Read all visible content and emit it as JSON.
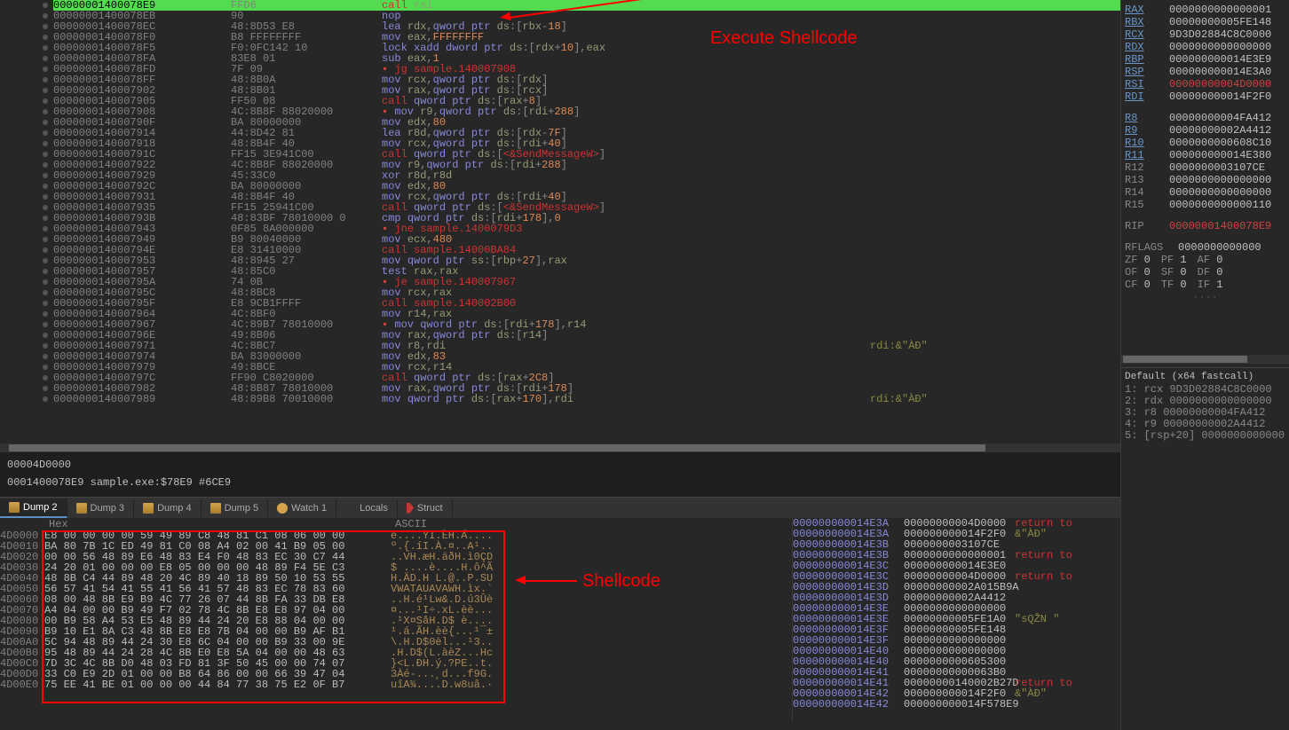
{
  "annotations": {
    "execute_shellcode": "Execute Shellcode",
    "shellcode": "Shellcode"
  },
  "status": {
    "line1": "00004D0000",
    "line2": "0001400078E9 sample.exe:$78E9 #6CE9"
  },
  "tabs": {
    "dump2": "Dump 2",
    "dump3": "Dump 3",
    "dump4": "Dump 4",
    "dump5": "Dump 5",
    "watch1": "Watch 1",
    "locals": "Locals",
    "struct": "Struct"
  },
  "hex_header": {
    "hex": "Hex",
    "ascii": "ASCII"
  },
  "disasm": [
    {
      "addr": "00000001400078E9",
      "bytes": "FFD6",
      "instr": [
        "call ",
        "rsi"
      ],
      "type": "call",
      "hl": true
    },
    {
      "addr": "00000001400078EB",
      "bytes": "90",
      "instr": [
        "nop"
      ],
      "type": "plain"
    },
    {
      "addr": "00000001400078EC",
      "bytes": "48:8D53 E8",
      "instr": [
        "lea ",
        "rdx",
        ",",
        "qword ptr ",
        "ds",
        ":",
        "[",
        "rbx",
        "-",
        "18",
        "]"
      ],
      "type": "plain"
    },
    {
      "addr": "00000001400078F0",
      "bytes": "B8 FFFFFFFF",
      "instr": [
        "mov ",
        "eax",
        ",",
        "FFFFFFFF"
      ],
      "type": "plain"
    },
    {
      "addr": "00000001400078F5",
      "bytes": "F0:0FC142 10",
      "instr": [
        "lock xadd ",
        "dword ptr ",
        "ds",
        ":",
        "[",
        "rdx",
        "+",
        "10",
        "],",
        "eax"
      ],
      "type": "plain"
    },
    {
      "addr": "00000001400078FA",
      "bytes": "83E8 01",
      "instr": [
        "sub ",
        "eax",
        ",",
        "1"
      ],
      "type": "plain"
    },
    {
      "addr": "00000001400078FD",
      "bytes": "7F 09",
      "instr": [
        "jg ",
        "sample.140007908"
      ],
      "type": "jmp",
      "marker": ">"
    },
    {
      "addr": "00000001400078FF",
      "bytes": "48:8B0A",
      "instr": [
        "mov ",
        "rcx",
        ",",
        "qword ptr ",
        "ds",
        ":",
        "[",
        "rdx",
        "]"
      ],
      "type": "plain"
    },
    {
      "addr": "0000000140007902",
      "bytes": "48:8B01",
      "instr": [
        "mov ",
        "rax",
        ",",
        "qword ptr ",
        "ds",
        ":",
        "[",
        "rcx",
        "]"
      ],
      "type": "plain"
    },
    {
      "addr": "0000000140007905",
      "bytes": "FF50 08",
      "instr": [
        "call ",
        "qword ptr ",
        "ds",
        ":",
        "[",
        "rax",
        "+",
        "8",
        "]"
      ],
      "type": "call"
    },
    {
      "addr": "0000000140007908",
      "bytes": "4C:8B8F 88020000",
      "instr": [
        "mov ",
        "r9",
        ",",
        "qword ptr ",
        "ds",
        ":",
        "[",
        "rdi",
        "+",
        "288",
        "]"
      ],
      "type": "plain",
      "marker": ">"
    },
    {
      "addr": "000000014000790F",
      "bytes": "BA 80000000",
      "instr": [
        "mov ",
        "edx",
        ",",
        "80"
      ],
      "type": "plain"
    },
    {
      "addr": "0000000140007914",
      "bytes": "44:8D42 81",
      "instr": [
        "lea ",
        "r8d",
        ",",
        "qword ptr ",
        "ds",
        ":",
        "[",
        "rdx",
        "-",
        "7F",
        "]"
      ],
      "type": "plain"
    },
    {
      "addr": "0000000140007918",
      "bytes": "48:8B4F 40",
      "instr": [
        "mov ",
        "rcx",
        ",",
        "qword ptr ",
        "ds",
        ":",
        "[",
        "rdi",
        "+",
        "40",
        "]"
      ],
      "type": "plain"
    },
    {
      "addr": "000000014000791C",
      "bytes": "FF15 3E941C00",
      "instr": [
        "call ",
        "qword ptr ",
        "ds",
        ":",
        "[",
        "<&SendMessageW>",
        "]"
      ],
      "type": "call"
    },
    {
      "addr": "0000000140007922",
      "bytes": "4C:8B8F 88020000",
      "instr": [
        "mov ",
        "r9",
        ",",
        "qword ptr ",
        "ds",
        ":",
        "[",
        "rdi",
        "+",
        "288",
        "]"
      ],
      "type": "plain"
    },
    {
      "addr": "0000000140007929",
      "bytes": "45:33C0",
      "instr": [
        "xor ",
        "r8d",
        ",",
        "r8d"
      ],
      "type": "plain"
    },
    {
      "addr": "000000014000792C",
      "bytes": "BA 80000000",
      "instr": [
        "mov ",
        "edx",
        ",",
        "80"
      ],
      "type": "plain"
    },
    {
      "addr": "0000000140007931",
      "bytes": "48:8B4F 40",
      "instr": [
        "mov ",
        "rcx",
        ",",
        "qword ptr ",
        "ds",
        ":",
        "[",
        "rdi",
        "+",
        "40",
        "]"
      ],
      "type": "plain"
    },
    {
      "addr": "0000000140007935",
      "bytes": "FF15 25941C00",
      "instr": [
        "call ",
        "qword ptr ",
        "ds",
        ":",
        "[",
        "<&SendMessageW>",
        "]"
      ],
      "type": "call"
    },
    {
      "addr": "000000014000793B",
      "bytes": "48:83BF 78010000 0",
      "instr": [
        "cmp ",
        "qword ptr ",
        "ds",
        ":",
        "[",
        "rdi",
        "+",
        "178",
        "],",
        "0"
      ],
      "type": "plain"
    },
    {
      "addr": "0000000140007943",
      "bytes": "0F85 8A000000",
      "instr": [
        "jne ",
        "sample.1400079D3"
      ],
      "type": "jmp",
      "marker": ">"
    },
    {
      "addr": "0000000140007949",
      "bytes": "B9 80040000",
      "instr": [
        "mov ",
        "ecx",
        ",",
        "480"
      ],
      "type": "plain"
    },
    {
      "addr": "000000014000794E",
      "bytes": "E8 31410000",
      "instr": [
        "call ",
        "sample.14000BA84"
      ],
      "type": "call"
    },
    {
      "addr": "0000000140007953",
      "bytes": "48:8945 27",
      "instr": [
        "mov ",
        "qword ptr ",
        "ss",
        ":",
        "[",
        "rbp",
        "+",
        "27",
        "],",
        "rax"
      ],
      "type": "plain"
    },
    {
      "addr": "0000000140007957",
      "bytes": "48:85C0",
      "instr": [
        "test ",
        "rax",
        ",",
        "rax"
      ],
      "type": "plain"
    },
    {
      "addr": "000000014000795A",
      "bytes": "74 0B",
      "instr": [
        "je ",
        "sample.140007967"
      ],
      "type": "jmp",
      "marker": ">"
    },
    {
      "addr": "000000014000795C",
      "bytes": "48:8BC8",
      "instr": [
        "mov ",
        "rcx",
        ",",
        "rax"
      ],
      "type": "plain"
    },
    {
      "addr": "000000014000795F",
      "bytes": "E8 9CB1FFFF",
      "instr": [
        "call ",
        "sample.140002B00"
      ],
      "type": "call"
    },
    {
      "addr": "0000000140007964",
      "bytes": "4C:8BF0",
      "instr": [
        "mov ",
        "r14",
        ",",
        "rax"
      ],
      "type": "plain"
    },
    {
      "addr": "0000000140007967",
      "bytes": "4C:89B7 78010000",
      "instr": [
        "mov ",
        "qword ptr ",
        "ds",
        ":",
        "[",
        "rdi",
        "+",
        "178",
        "],",
        "r14"
      ],
      "type": "plain",
      "marker": ">"
    },
    {
      "addr": "000000014000796E",
      "bytes": "49:8B06",
      "instr": [
        "mov ",
        "rax",
        ",",
        "qword ptr ",
        "ds",
        ":",
        "[",
        "r14",
        "]"
      ],
      "type": "plain"
    },
    {
      "addr": "0000000140007971",
      "bytes": "4C:8BC7",
      "instr": [
        "mov ",
        "r8",
        ",",
        "rdi"
      ],
      "type": "plain",
      "cmnt": "rdi:&\"ÀÐ\""
    },
    {
      "addr": "0000000140007974",
      "bytes": "BA 83000000",
      "instr": [
        "mov ",
        "edx",
        ",",
        "83"
      ],
      "type": "plain"
    },
    {
      "addr": "0000000140007979",
      "bytes": "49:8BCE",
      "instr": [
        "mov ",
        "rcx",
        ",",
        "r14"
      ],
      "type": "plain"
    },
    {
      "addr": "000000014000797C",
      "bytes": "FF90 C8020000",
      "instr": [
        "call ",
        "qword ptr ",
        "ds",
        ":",
        "[",
        "rax",
        "+",
        "2C8",
        "]"
      ],
      "type": "call"
    },
    {
      "addr": "0000000140007982",
      "bytes": "48:8B87 78010000",
      "instr": [
        "mov ",
        "rax",
        ",",
        "qword ptr ",
        "ds",
        ":",
        "[",
        "rdi",
        "+",
        "178",
        "]"
      ],
      "type": "plain"
    },
    {
      "addr": "0000000140007989",
      "bytes": "48:89B8 70010000",
      "instr": [
        "mov ",
        "qword ptr ",
        "ds",
        ":",
        "[",
        "rax",
        "+",
        "170",
        "],",
        "rdi"
      ],
      "type": "plain",
      "cmnt": "rdi:&\"ÀÐ\""
    }
  ],
  "registers": [
    {
      "name": "RAX",
      "val": "0000000000000001"
    },
    {
      "name": "RBX",
      "val": "00000000005FE148"
    },
    {
      "name": "RCX",
      "val": "9D3D02884C8C0000"
    },
    {
      "name": "RDX",
      "val": "0000000000000000"
    },
    {
      "name": "RBP",
      "val": "000000000014E3E9"
    },
    {
      "name": "RSP",
      "val": "000000000014E3A0"
    },
    {
      "name": "RSI",
      "val": "00000000004D0000",
      "red": true
    },
    {
      "name": "RDI",
      "val": "000000000014F2F0"
    }
  ],
  "registers2": [
    {
      "name": "R8",
      "val": "00000000004FA412"
    },
    {
      "name": "R9",
      "val": "00000000002A4412"
    },
    {
      "name": "R10",
      "val": "0000000000608C10"
    },
    {
      "name": "R11",
      "val": "000000000014E380"
    },
    {
      "name": "R12",
      "val": "0000000003107CE",
      "plain": true
    },
    {
      "name": "R13",
      "val": "0000000000000000",
      "plain": true
    },
    {
      "name": "R14",
      "val": "0000000000000000",
      "plain": true
    },
    {
      "name": "R15",
      "val": "0000000000000110",
      "plain": true
    }
  ],
  "rip": {
    "name": "RIP",
    "val": "00000001400078E9"
  },
  "rflags": {
    "label": "RFLAGS",
    "val": "0000000000000"
  },
  "flags": [
    [
      "ZF",
      "0",
      "PF",
      "1",
      "AF",
      "0"
    ],
    [
      "OF",
      "0",
      "SF",
      "0",
      "DF",
      "0"
    ],
    [
      "CF",
      "0",
      "TF",
      "0",
      "IF",
      "1"
    ]
  ],
  "calling_conv": {
    "header": "Default (x64 fastcall)",
    "rows": [
      "1: rcx 9D3D02884C8C0000",
      "2: rdx 0000000000000000",
      "3: r8 00000000004FA412",
      "4: r9 00000000002A4412",
      "5: [rsp+20] 0000000000000"
    ]
  },
  "hex_dump": [
    {
      "addr": "4D0000",
      "bytes": "E8 00 00 00 00 59 49 89 C8 48 81 C1 08 06 00 00",
      "ascii": "è....YI.ÈH.Á...."
    },
    {
      "addr": "4D0010",
      "bytes": "BA 80 7B 1C ED 49 81 C0 08 A4 02 00 41 B9 05 00",
      "ascii": "º.{.íI.À.¤..A¹.."
    },
    {
      "addr": "4D0020",
      "bytes": "00 00 56 48 89 E6 48 83 E4 F0 48 83 EC 30 C7 44",
      "ascii": "..VH.æH.äðH.ì0ÇD"
    },
    {
      "addr": "4D0030",
      "bytes": "24 20 01 00 00 00 E8 05 00 00 00 48 89 F4 5E C3",
      "ascii": "$ ....è....H.ô^Ã"
    },
    {
      "addr": "4D0040",
      "bytes": "48 8B C4 44 89 48 20 4C 89 40 18 89 50 10 53 55",
      "ascii": "H.ÄD.H L.@..P.SU"
    },
    {
      "addr": "4D0050",
      "bytes": "56 57 41 54 41 55 41 56 41 57 48 83 EC 78 83 60",
      "ascii": "VWATAUAVAWH.ìx.`"
    },
    {
      "addr": "4D0060",
      "bytes": "08 00 48 8B E9 B9 4C 77 26 07 44 8B FA 33 DB E8",
      "ascii": "..H.é¹Lw&.D.ú3Ûè"
    },
    {
      "addr": "4D0070",
      "bytes": "A4 04 00 00 B9 49 F7 02 78 4C 8B E8 E8 97 04 00",
      "ascii": "¤...¹I÷.xL.èè..."
    },
    {
      "addr": "4D0080",
      "bytes": "00 B9 58 A4 53 E5 48 89 44 24 20 E8 88 04 00 00",
      "ascii": ".¹X¤SåH.D$ è...."
    },
    {
      "addr": "4D0090",
      "bytes": "B9 10 E1 8A C3 48 8B E8 E8 7B 04 00 00 B9 AF B1",
      "ascii": "¹.á.ÃH.èè{...¹¯±"
    },
    {
      "addr": "4D00A0",
      "bytes": "5C 94 48 89 44 24 30 E8 6C 04 00 00 B9 33 00 9E",
      "ascii": "\\.H.D$0èl...¹3.."
    },
    {
      "addr": "4D00B0",
      "bytes": "95 48 89 44 24 28 4C 8B E0 E8 5A 04 00 00 48 63",
      "ascii": ".H.D$(L.àèZ...Hc"
    },
    {
      "addr": "4D00C0",
      "bytes": "7D 3C 4C 8B D0 48 03 FD 81 3F 50 45 00 00 74 07",
      "ascii": "}<L.ÐH.ý.?PE..t."
    },
    {
      "addr": "4D00D0",
      "bytes": "33 C0 E9 2D 01 00 00 B8 64 86 00 00 66 39 47 04",
      "ascii": "3Àé-...¸d...f9G."
    },
    {
      "addr": "4D00E0",
      "bytes": "75 EE 41 BE 01 00 00 00 44 84 77 38 75 E2 0F B7",
      "ascii": "uîA¾....D.w8uâ.·"
    }
  ],
  "stack": [
    {
      "addr": "000000000014E3A",
      "val": "00000000004D0000",
      "cmnt": "return to",
      "type": "ret"
    },
    {
      "addr": "000000000014E3A",
      "val": "000000000014F2F0",
      "cmnt": "&\"ÀÐ\"",
      "type": "gray"
    },
    {
      "addr": "000000000014E3B",
      "val": "0000000003107CE",
      "cmnt": "",
      "type": ""
    },
    {
      "addr": "000000000014E3B",
      "val": "0000000000000001",
      "cmnt": "return to",
      "type": "ret"
    },
    {
      "addr": "000000000014E3C",
      "val": "000000000014E3E0",
      "cmnt": "",
      "type": ""
    },
    {
      "addr": "000000000014E3C",
      "val": "00000000004D0000",
      "cmnt": "return to",
      "type": "ret"
    },
    {
      "addr": "000000000014E3D",
      "val": "00000000002A015B9A",
      "cmnt": "",
      "type": ""
    },
    {
      "addr": "000000000014E3D",
      "val": "00000000002A4412",
      "cmnt": "",
      "type": ""
    },
    {
      "addr": "000000000014E3E",
      "val": "0000000000000000",
      "cmnt": "",
      "type": ""
    },
    {
      "addr": "000000000014E3E",
      "val": "00000000005FE1A0",
      "cmnt": "\"sQŽN \"",
      "type": "gray"
    },
    {
      "addr": "000000000014E3F",
      "val": "00000000005FE148",
      "cmnt": "",
      "type": ""
    },
    {
      "addr": "000000000014E3F",
      "val": "0000000000000000",
      "cmnt": "",
      "type": ""
    },
    {
      "addr": "000000000014E40",
      "val": "0000000000000000",
      "cmnt": "",
      "type": ""
    },
    {
      "addr": "000000000014E40",
      "val": "0000000000605300",
      "cmnt": "",
      "type": ""
    },
    {
      "addr": "000000000014E41",
      "val": "00000000000063B0",
      "cmnt": "",
      "type": ""
    },
    {
      "addr": "000000000014E41",
      "val": "00000000140002B27D",
      "cmnt": "return to",
      "type": "ret"
    },
    {
      "addr": "000000000014E42",
      "val": "000000000014F2F0",
      "cmnt": "&\"ÀÐ\"",
      "type": "gray"
    },
    {
      "addr": "000000000014E42",
      "val": "000000000014F578E9",
      "cmnt": "",
      "type": ""
    }
  ]
}
